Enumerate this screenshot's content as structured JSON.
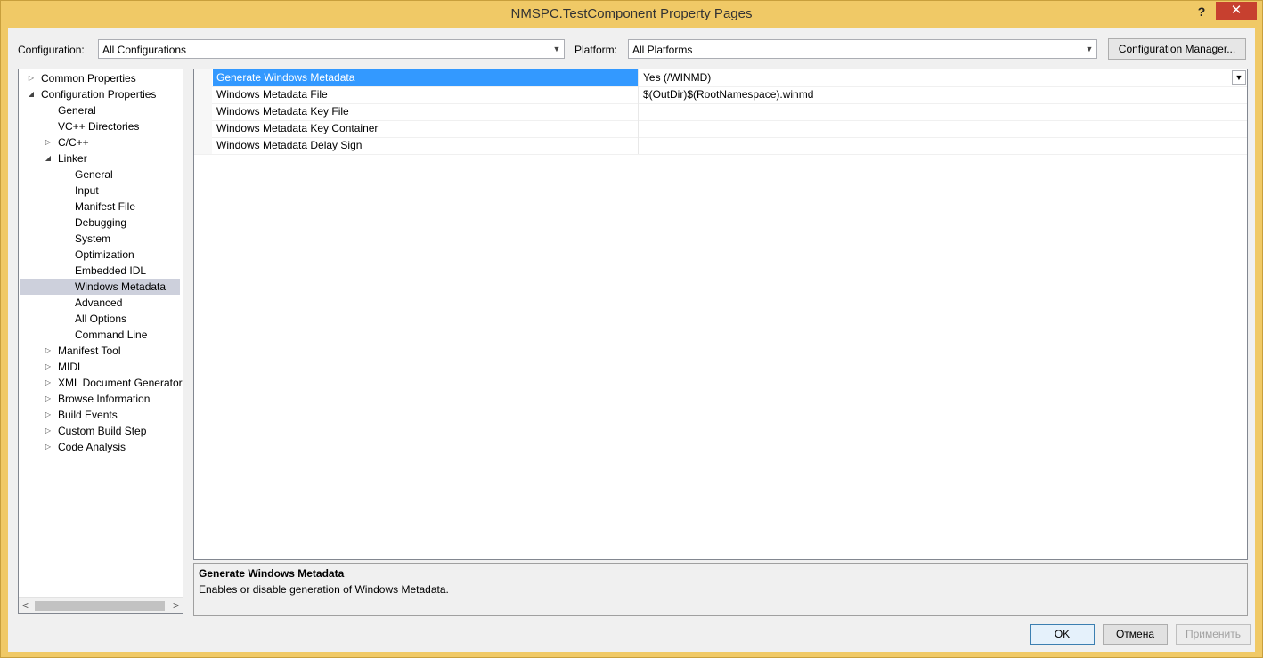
{
  "window": {
    "title": "NMSPC.TestComponent Property Pages"
  },
  "titlebar": {
    "help_glyph": "?",
    "close_glyph": "✕"
  },
  "topbar": {
    "configuration_label": "Configuration:",
    "configuration_value": "All Configurations",
    "platform_label": "Platform:",
    "platform_value": "All Platforms",
    "config_manager_label": "Configuration Manager..."
  },
  "tree": {
    "items": [
      {
        "label": "Common Properties",
        "expander": "▷",
        "level": 0
      },
      {
        "label": "Configuration Properties",
        "expander": "◢",
        "level": 0
      },
      {
        "label": "General",
        "expander": "",
        "level": 1
      },
      {
        "label": "VC++ Directories",
        "expander": "",
        "level": 1
      },
      {
        "label": "C/C++",
        "expander": "▷",
        "level": 1
      },
      {
        "label": "Linker",
        "expander": "◢",
        "level": 1
      },
      {
        "label": "General",
        "expander": "",
        "level": 2
      },
      {
        "label": "Input",
        "expander": "",
        "level": 2
      },
      {
        "label": "Manifest File",
        "expander": "",
        "level": 2
      },
      {
        "label": "Debugging",
        "expander": "",
        "level": 2
      },
      {
        "label": "System",
        "expander": "",
        "level": 2
      },
      {
        "label": "Optimization",
        "expander": "",
        "level": 2
      },
      {
        "label": "Embedded IDL",
        "expander": "",
        "level": 2
      },
      {
        "label": "Windows Metadata",
        "expander": "",
        "level": 2,
        "selected": true
      },
      {
        "label": "Advanced",
        "expander": "",
        "level": 2
      },
      {
        "label": "All Options",
        "expander": "",
        "level": 2
      },
      {
        "label": "Command Line",
        "expander": "",
        "level": 2
      },
      {
        "label": "Manifest Tool",
        "expander": "▷",
        "level": 1
      },
      {
        "label": "MIDL",
        "expander": "▷",
        "level": 1
      },
      {
        "label": "XML Document Generator",
        "expander": "▷",
        "level": 1
      },
      {
        "label": "Browse Information",
        "expander": "▷",
        "level": 1
      },
      {
        "label": "Build Events",
        "expander": "▷",
        "level": 1
      },
      {
        "label": "Custom Build Step",
        "expander": "▷",
        "level": 1
      },
      {
        "label": "Code Analysis",
        "expander": "▷",
        "level": 1
      }
    ],
    "scroll_left": "<",
    "scroll_right": ">"
  },
  "grid": {
    "rows": [
      {
        "name": "Generate Windows Metadata",
        "value": "Yes (/WINMD)",
        "selected": true
      },
      {
        "name": "Windows Metadata File",
        "value": "$(OutDir)$(RootNamespace).winmd"
      },
      {
        "name": "Windows Metadata Key File",
        "value": ""
      },
      {
        "name": "Windows Metadata Key Container",
        "value": ""
      },
      {
        "name": "Windows Metadata Delay Sign",
        "value": ""
      }
    ]
  },
  "description": {
    "title": "Generate Windows Metadata",
    "text": "Enables or disable generation of Windows Metadata."
  },
  "buttons": {
    "ok": "OK",
    "cancel": "Отмена",
    "apply": "Применить"
  },
  "colors": {
    "selection": "#3399ff",
    "tree_selection": "#cdd0dc",
    "close": "#c7402f",
    "frame": "#f0c966"
  }
}
